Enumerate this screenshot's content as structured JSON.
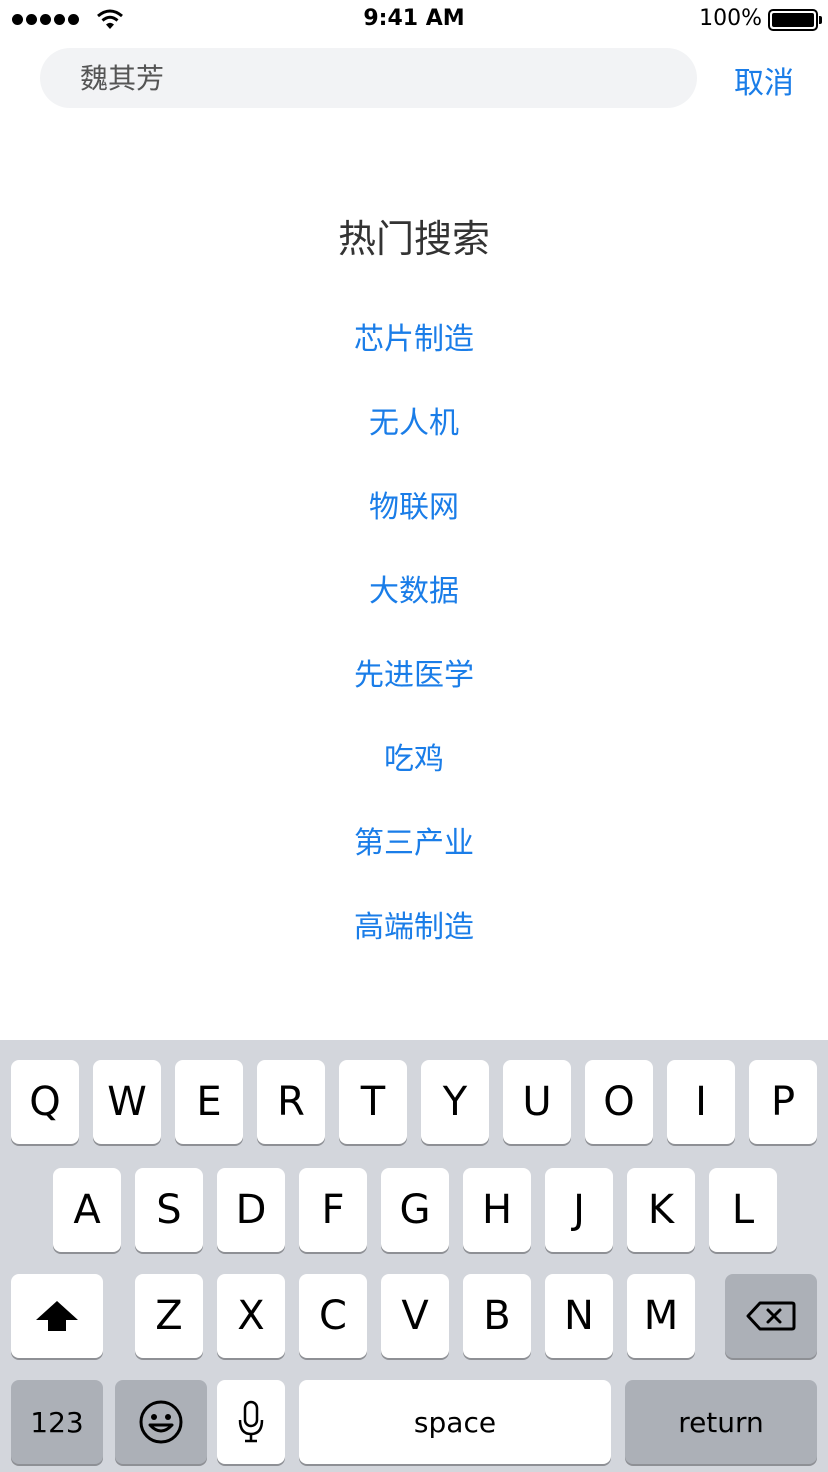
{
  "status_bar": {
    "time": "9:41 AM",
    "battery_percent": "100%",
    "signal_icon": "signal-dots-icon",
    "wifi_icon": "wifi-icon",
    "battery_icon": "battery-icon"
  },
  "search": {
    "value": "",
    "placeholder": "魏其芳",
    "cancel_label": "取消"
  },
  "hot_search": {
    "title": "热门搜索",
    "items": [
      "芯片制造",
      "无人机",
      "物联网",
      "大数据",
      "先进医学",
      "吃鸡",
      "第三产业",
      "高端制造"
    ]
  },
  "keyboard": {
    "row1": [
      "Q",
      "W",
      "E",
      "R",
      "T",
      "Y",
      "U",
      "O",
      "I",
      "P"
    ],
    "row2": [
      "A",
      "S",
      "D",
      "F",
      "G",
      "H",
      "J",
      "K",
      "L"
    ],
    "row3": [
      "Z",
      "X",
      "C",
      "V",
      "B",
      "N",
      "M"
    ],
    "numbers_label": "123",
    "space_label": "space",
    "return_label": "return",
    "shift_icon": "shift-icon",
    "delete_icon": "delete-icon",
    "emoji_icon": "emoji-icon",
    "mic_icon": "microphone-icon"
  },
  "colors": {
    "accent": "#1a7de8",
    "keyboard_bg": "#d3d6dc",
    "search_bg": "#f2f3f5"
  }
}
